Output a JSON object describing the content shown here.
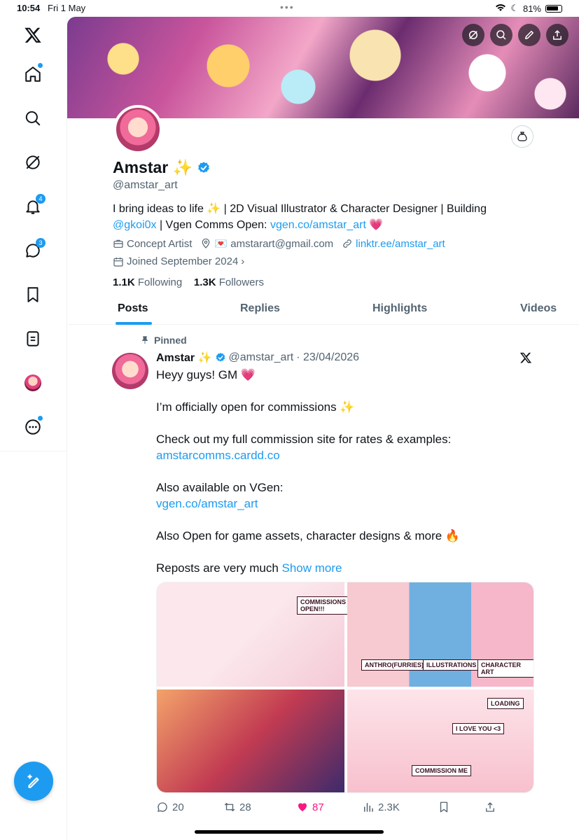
{
  "status_bar": {
    "time": "10:54",
    "date": "Fri 1 May",
    "battery": "81%"
  },
  "sidebar": {
    "notifications_badge": "4",
    "messages_badge": "3"
  },
  "profile": {
    "name": "Amstar ✨",
    "handle": "@amstar_art",
    "bio_part1": "I bring ideas to life ✨ | 2D Visual Illustrator & Character Designer | Building ",
    "bio_mention": "@gkoi0x",
    "bio_part2": " | Vgen Comms Open: ",
    "bio_link": "vgen.co/amstar_art",
    "bio_emoji": " 💗",
    "category": "Concept Artist",
    "email": "💌 amstarart@gmail.com",
    "website": "linktr.ee/amstar_art",
    "joined": "Joined September 2024",
    "following_count": "1.1K",
    "following_label": "Following",
    "followers_count": "1.3K",
    "followers_label": "Followers"
  },
  "tabs": [
    "Posts",
    "Replies",
    "Highlights",
    "Videos"
  ],
  "post": {
    "pinned_label": "Pinned",
    "author_name": "Amstar ✨",
    "author_handle": "@amstar_art",
    "date": "· 23/04/2026",
    "line1": "Heyy guys! GM 💗",
    "line2": "I’m officially open for commissions ✨",
    "line3": "Check out my full commission site for rates & examples:",
    "link1": "amstarcomms.cardd.co",
    "line4": "Also available on VGen:",
    "link2": "vgen.co/amstar_art",
    "line5": "Also Open for game assets, character designs & more 🔥",
    "line6": "Reposts are very much ",
    "show_more": "Show more",
    "media": {
      "m1_label": "COMMISSIONS OPEN!!!",
      "m2_label_a": "ANTHRO(FURRIES)",
      "m2_label_b": "ILLUSTRATIONS",
      "m2_label_c": "CHARACTER ART",
      "m4_label": "COMMISSION ME",
      "m4_loading": "LOADING",
      "m4_love": "I LOVE YOU <3"
    },
    "replies": "20",
    "reposts": "28",
    "likes": "87",
    "views": "2.3K"
  },
  "colors": {
    "accent": "#1d9bf0",
    "like": "#f91880",
    "muted": "#536471"
  }
}
